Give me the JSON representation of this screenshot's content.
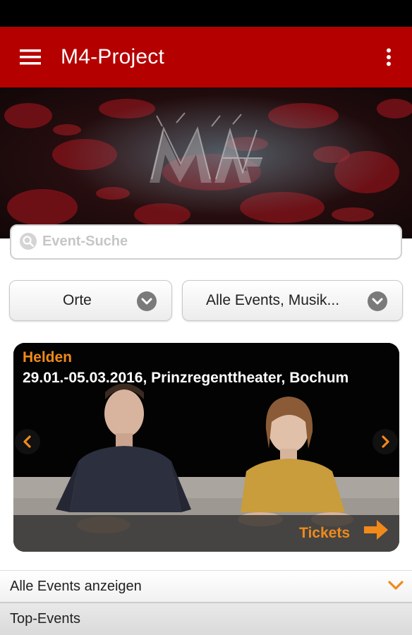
{
  "app_bar": {
    "title": "M4-Project",
    "menu_icon": "hamburger-menu-icon",
    "overflow_icon": "more-vert-icon",
    "color": "#b50000"
  },
  "banner": {
    "logo_text": "M4"
  },
  "search": {
    "placeholder": "Event-Suche",
    "icon": "search-icon"
  },
  "filters": {
    "places_label": "Orte",
    "events_label": "Alle Events, Musik..."
  },
  "featured_event": {
    "title": "Helden",
    "subtitle": "29.01.-05.03.2016, Prinzregenttheater, Bochum",
    "tickets_label": "Tickets",
    "accent_color": "#f08a1a"
  },
  "sections": {
    "all_events_label": "Alle Events anzeigen",
    "top_events_label": "Top-Events"
  }
}
